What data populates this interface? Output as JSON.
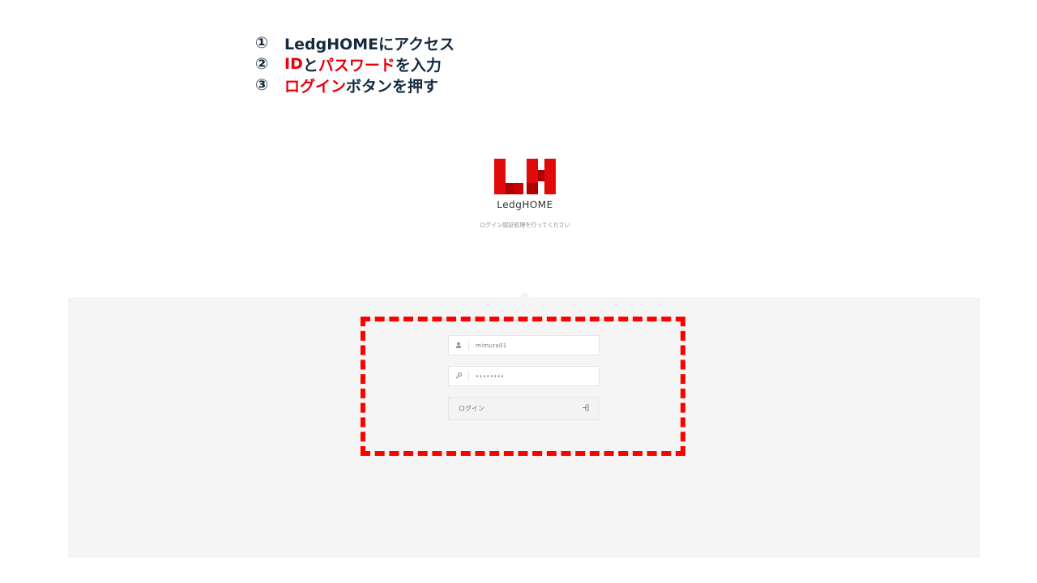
{
  "instructions": [
    {
      "num": "①",
      "parts": [
        {
          "text": "LedgHOMEにアクセス",
          "red": false
        }
      ]
    },
    {
      "num": "②",
      "parts": [
        {
          "text": "ID",
          "red": true
        },
        {
          "text": "と",
          "red": false
        },
        {
          "text": "パスワード",
          "red": true
        },
        {
          "text": "を入力",
          "red": false
        }
      ]
    },
    {
      "num": "③",
      "parts": [
        {
          "text": "ログイン",
          "red": true
        },
        {
          "text": "ボタンを押す",
          "red": false
        }
      ]
    }
  ],
  "brand": {
    "name": "LedgHOME",
    "subtitle": "ログイン認証処理を行ってください",
    "logo_colors": {
      "light": "#e10a0a",
      "dark": "#b10000"
    }
  },
  "login_form": {
    "username": {
      "value": "mimura01",
      "icon": "user-icon"
    },
    "password": {
      "value": "••••••••",
      "icon": "key-icon"
    },
    "submit": {
      "label": "ログイン",
      "icon": "sign-in-icon"
    }
  },
  "colors": {
    "instruction_text": "#152a3f",
    "highlight_red": "#ff0000",
    "panel_background": "#f5f5f5"
  }
}
